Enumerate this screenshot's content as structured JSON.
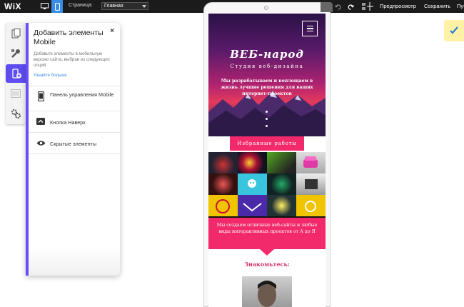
{
  "topbar": {
    "logo": "WiX",
    "page_label": "Страница:",
    "page_value": "Главная",
    "preview": "Предпросмотр",
    "save": "Сохранить",
    "publish": "Пуб"
  },
  "panel": {
    "title": "Добавить элементы Mobile",
    "close": "×",
    "description": "Добавьте элементы в мобильную версию сайта, выбрав из следующих опций:",
    "learn_more": "Узнайте больше",
    "items": [
      {
        "label": "Панель управления Mobile",
        "icon": "phone-icon"
      },
      {
        "label": "Кнопка Наверх",
        "icon": "chevron-up-icon"
      },
      {
        "label": "Скрытые элементы",
        "icon": "eye-icon"
      }
    ]
  },
  "site": {
    "title": "ВЕБ-народ",
    "subtitle": "Студия веб-дизайна",
    "tagline": "Мы разрабатываем и воплощаем в жизнь лучшие решения для ваших интернет-проектов",
    "works_button": "Избранные работы",
    "band_text": "Мы создаем отличные веб-сайты и любые виды интерактивных проектов от А до Я",
    "meet": "Знакомьтесь:"
  },
  "colors": {
    "accent": "#f22a6b",
    "panel_accent": "#6a4dfa",
    "mobile_active": "#3a8de6"
  }
}
